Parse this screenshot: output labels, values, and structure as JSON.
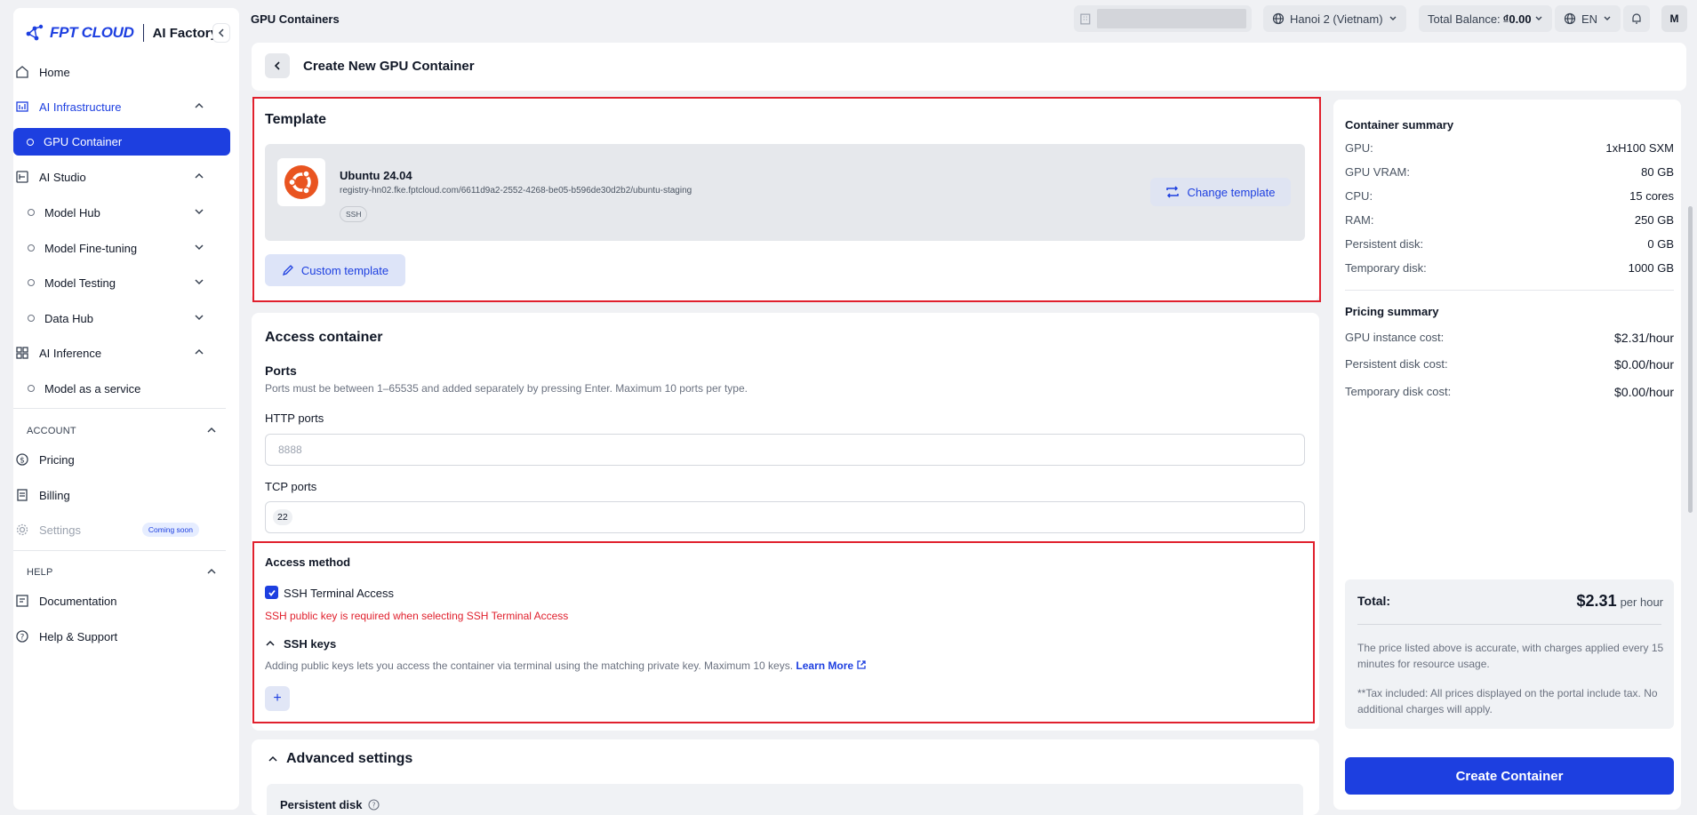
{
  "sidebar": {
    "logo_brand": "FPT CLOUD",
    "logo_product": "AI Factory",
    "items": {
      "home": "Home",
      "ai_infrastructure": "AI Infrastructure",
      "gpu_container": "GPU Container",
      "ai_studio": "AI Studio",
      "model_hub": "Model Hub",
      "model_finetuning": "Model Fine-tuning",
      "model_testing": "Model Testing",
      "data_hub": "Data Hub",
      "ai_inference": "AI Inference",
      "model_as_a_service": "Model as a service"
    },
    "account_section": "ACCOUNT",
    "account": {
      "pricing": "Pricing",
      "billing": "Billing",
      "settings": "Settings",
      "settings_badge": "Coming soon"
    },
    "help_section": "HELP",
    "help": {
      "documentation": "Documentation",
      "support": "Help & Support"
    }
  },
  "header": {
    "title": "GPU Containers",
    "region": "Hanoi 2 (Vietnam)",
    "balance_label": "Total Balance:",
    "balance_value": "₫0.00",
    "language": "EN",
    "avatar_initial": "M"
  },
  "page": {
    "heading": "Create New GPU Container"
  },
  "template": {
    "title": "Template",
    "name": "Ubuntu 24.04",
    "registry": "registry-hn02.fke.fptcloud.com/6611d9a2-2552-4268-be05-b596de30d2b2/ubuntu-staging",
    "tag": "SSH",
    "change_button": "Change template",
    "custom_button": "Custom template"
  },
  "access": {
    "title": "Access container",
    "ports_label": "Ports",
    "ports_hint": "Ports must be between 1–65535 and added separately by pressing Enter. Maximum 10 ports per type.",
    "http_label": "HTTP ports",
    "http_placeholder": "8888",
    "tcp_label": "TCP ports",
    "tcp_value": "22",
    "method_title": "Access method",
    "ssh_terminal": "SSH Terminal Access",
    "ssh_terminal_checked": true,
    "ssh_error": "SSH public key is required when selecting SSH Terminal Access",
    "ssh_keys_label": "SSH keys",
    "ssh_keys_hint": "Adding public keys lets you access the container via terminal using the matching private key. Maximum 10 keys.",
    "learn_more": "Learn More",
    "add_key": "+"
  },
  "advanced": {
    "title": "Advanced settings",
    "persistent_disk_label": "Persistent disk"
  },
  "summary": {
    "container_title": "Container summary",
    "container_rows": [
      {
        "k": "GPU:",
        "v": "1xH100 SXM"
      },
      {
        "k": "GPU VRAM:",
        "v": "80 GB"
      },
      {
        "k": "CPU:",
        "v": "15 cores"
      },
      {
        "k": "RAM:",
        "v": "250 GB"
      },
      {
        "k": "Persistent disk:",
        "v": "0 GB"
      },
      {
        "k": "Temporary disk:",
        "v": "1000 GB"
      }
    ],
    "pricing_title": "Pricing summary",
    "pricing_rows": [
      {
        "k": "GPU instance cost:",
        "v": "$2.31/hour"
      },
      {
        "k": "Persistent disk cost:",
        "v": "$0.00/hour"
      },
      {
        "k": "Temporary disk cost:",
        "v": "$0.00/hour"
      }
    ],
    "total_label": "Total:",
    "total_value": "$2.31",
    "total_unit": "per hour",
    "note_1": "The price listed above is accurate, with charges applied every 15 minutes for resource usage.",
    "note_2": "**Tax included: All prices displayed on the portal include tax. No additional charges will apply.",
    "create_button": "Create Container"
  },
  "colors": {
    "primary": "#1d3fe0",
    "error": "#e0202d",
    "ubuntu_orange": "#e95420"
  }
}
